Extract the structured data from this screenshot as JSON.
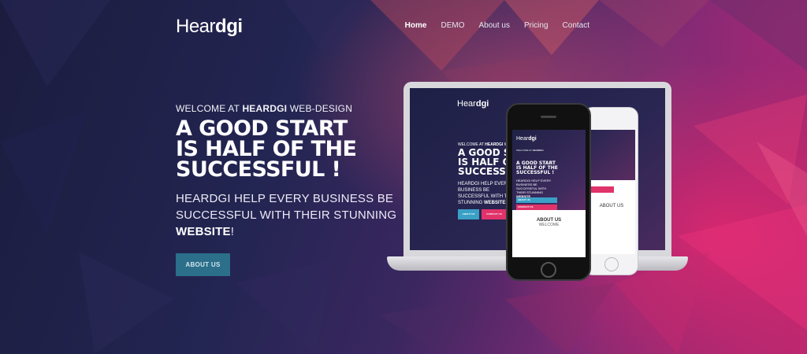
{
  "brand": {
    "light": "Hear",
    "bold": "dgi"
  },
  "nav": [
    {
      "label": "Home",
      "active": true
    },
    {
      "label": "DEMO",
      "active": false
    },
    {
      "label": "About us",
      "active": false
    },
    {
      "label": "Pricing",
      "active": false
    },
    {
      "label": "Contact",
      "active": false
    }
  ],
  "hero": {
    "welcome_pre": "WELCOME AT ",
    "welcome_bold": "HEARDGI",
    "welcome_post": " WEB-DESIGN",
    "headline": "A GOOD START\nIS HALF OF THE\nSUCCESSFUL !",
    "sub_text": "HEARDGI HELP EVERY BUSINESS BE SUCCESSFUL WITH THEIR STUNNING ",
    "sub_bold": "WEBSITE",
    "sub_end": "!",
    "cta": "ABOUT US"
  },
  "mockup": {
    "contact_btn": "CONTACT US",
    "about_title": "ABOUT US",
    "about_sub": "WELCOME"
  },
  "colors": {
    "accent": "#2c6f8a",
    "pink": "#e0336a",
    "blue": "#3aa0c6"
  }
}
